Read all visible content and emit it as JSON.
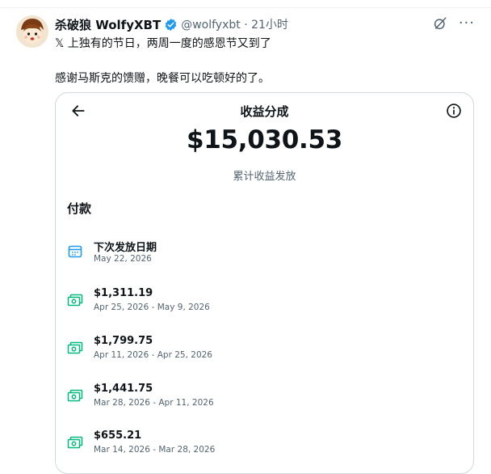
{
  "tweet": {
    "display_name": "杀破狼 WolfyXBT",
    "handle_time": "@wolfyxbt · 21小时",
    "line1": "𝕏 上独有的节日，两周一度的感恩节又到了",
    "line2": "感谢马斯克的馈赠，晚餐可以吃顿好的了。"
  },
  "card": {
    "title": "收益分成",
    "amount": "$15,030.53",
    "subtitle": "累计收益发放",
    "section": "付款",
    "next_payout": {
      "label": "下次发放日期",
      "date": "May 22, 2026"
    },
    "payments": [
      {
        "amount": "$1,311.19",
        "range": "Apr 25, 2026 - May 9, 2026"
      },
      {
        "amount": "$1,799.75",
        "range": "Apr 11, 2026 - Apr 25, 2026"
      },
      {
        "amount": "$1,441.75",
        "range": "Mar 28, 2026 - Apr 11, 2026"
      },
      {
        "amount": "$655.21",
        "range": "Mar 14, 2026 - Mar 28, 2026"
      }
    ]
  },
  "icons": {
    "verified": "verified-badge-icon",
    "grok": "grok-icon",
    "more": "more-icon",
    "back": "back-arrow-icon",
    "info": "info-icon",
    "calendar": "calendar-icon",
    "money": "money-icon"
  },
  "colors": {
    "verified_blue": "#1d9bf0",
    "money_green": "#00ba7c",
    "muted": "#536471"
  }
}
